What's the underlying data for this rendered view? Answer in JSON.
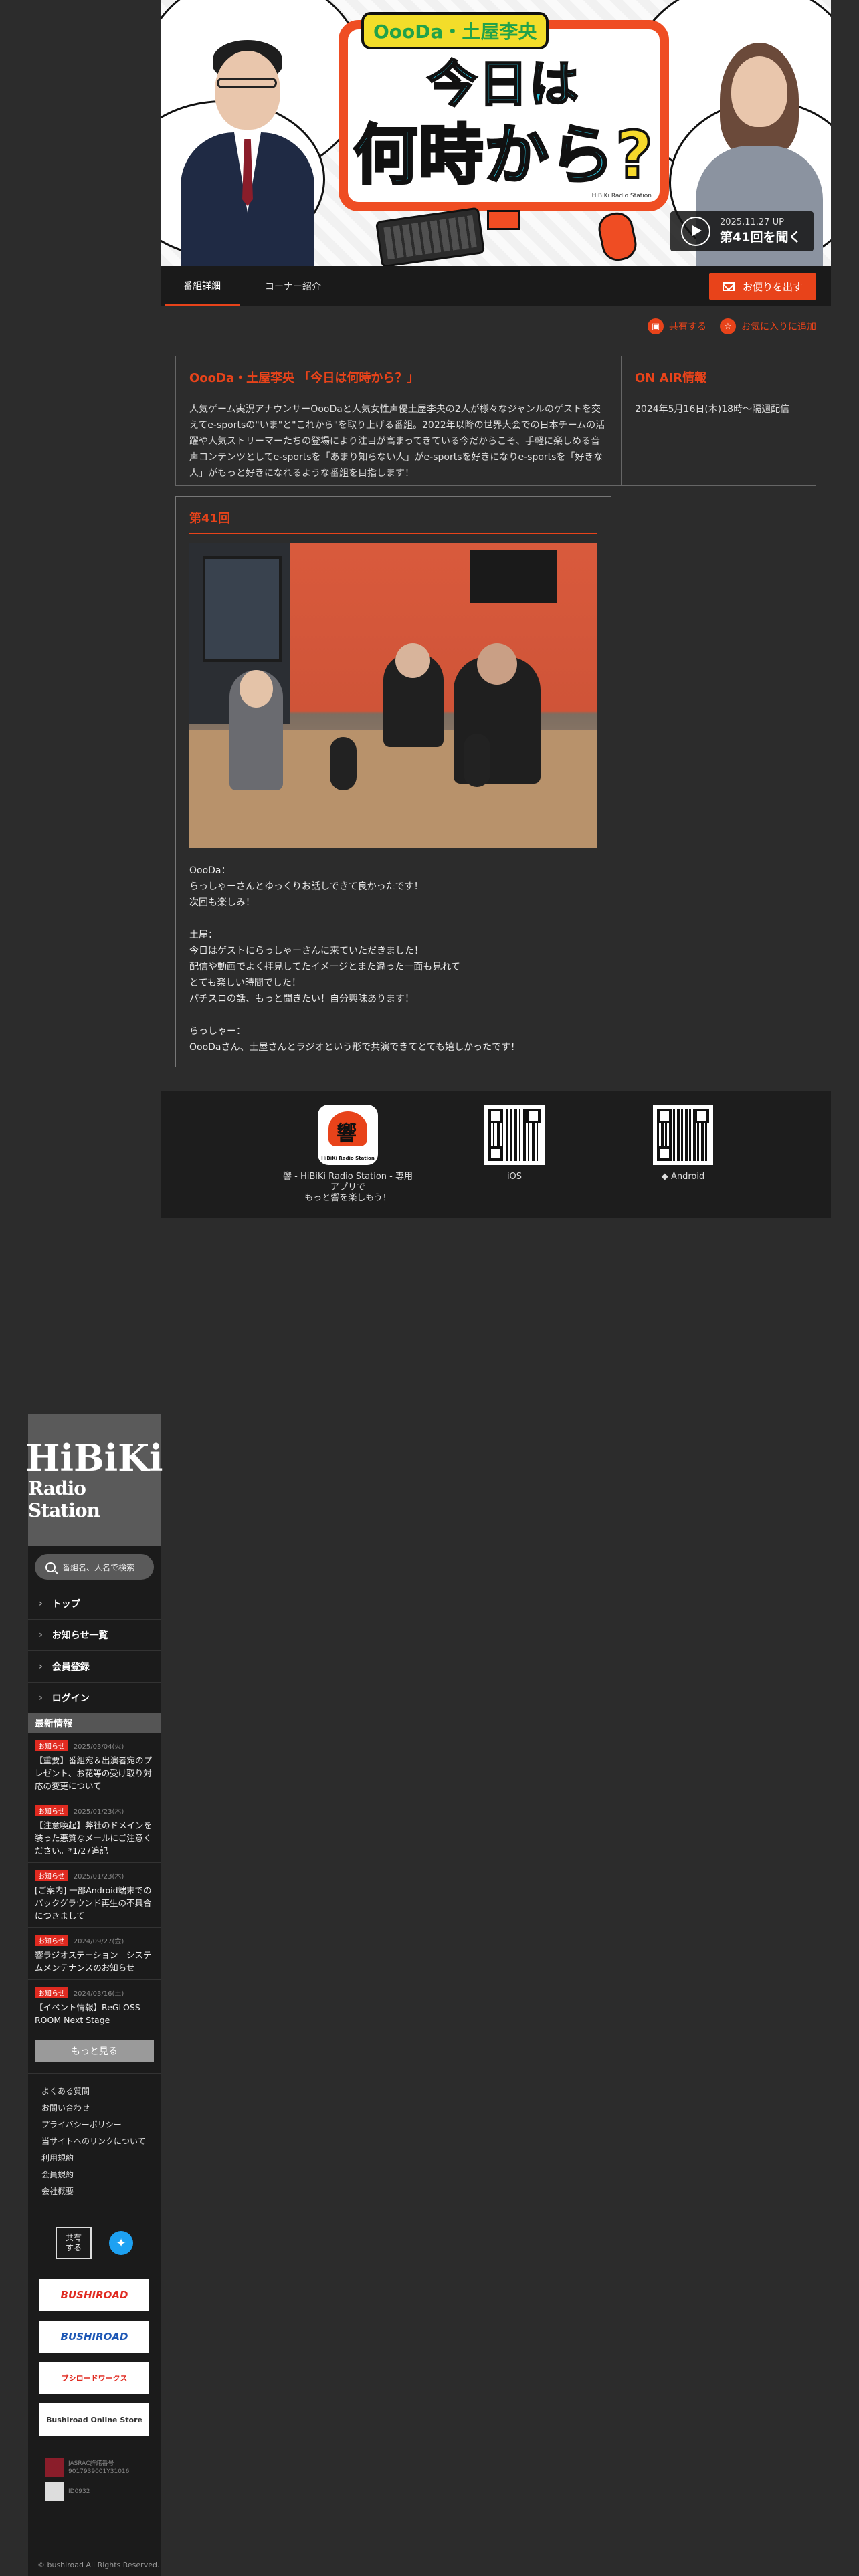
{
  "banner": {
    "logo_top": "OooDa・土屋李央",
    "logo_line1": "今日は",
    "logo_line2_a": "何時から",
    "logo_line2_b": "?",
    "credit": "HiBiKi Radio Station",
    "latest_date": "2025.11.27 UP",
    "latest_label": "第41回を聞く"
  },
  "tabs": [
    {
      "label": "番組詳細"
    },
    {
      "label": "コーナー紹介"
    }
  ],
  "letter_button": "お便りを出す",
  "actions": {
    "share": "共有する",
    "favorite": "お気に入りに追加"
  },
  "program": {
    "title": "OooDa・土屋李央 「今日は何時から？」",
    "description": "人気ゲーム実況アナウンサーOooDaと人気女性声優土屋李央の2人が様々なジャンルのゲストを交えてe-sportsの\"いま\"と\"これから\"を取り上げる番組。2022年以降の世界大会での日本チームの活躍や人気ストリーマーたちの登場により注目が高まってきている今だからこそ、手軽に楽しめる音声コンテンツとしてe-sportsを「あまり知らない人」がe-sportsを好きになりe-sportsを「好きな人」がもっと好きになれるような番組を目指します！",
    "onair_title": "ON AIR情報",
    "onair_text": "2024年5月16日(木)18時〜隔週配信"
  },
  "episode": {
    "title": "第41回",
    "paragraphs": [
      "OooDa：\nらっしゃーさんとゆっくりお話しできて良かったです！\n次回も楽しみ！",
      "土屋：\n今日はゲストにらっしゃーさんに来ていただきました！\n配信や動画でよく拝見してたイメージとまた違った一面も見れて\nとても楽しい時間でした！\nパチスロの話、もっと聞きたい！自分興味あります！",
      "らっしゃー：\nOooDaさん、土屋さんとラジオという形で共演できてとても嬉しかったです！"
    ]
  },
  "apps": {
    "app_caption": "響 - HiBiKi Radio Station - 専用アプリで\nもっと響を楽しもう！",
    "app_icon_text": "HiBiKi Radio Station",
    "ios": "iOS",
    "android": "Android"
  },
  "sidebar": {
    "logo_a": "HiBiKi",
    "logo_b": "Radio Station",
    "search_placeholder": "番組名、人名で検索",
    "nav": [
      "トップ",
      "お知らせ一覧",
      "会員登録",
      "ログイン"
    ],
    "news_heading": "最新情報",
    "news": [
      {
        "badge": "お知らせ",
        "date": "2025/03/04(火)",
        "text": "【重要】番組宛＆出演者宛のプレゼント、お花等の受け取り対応の変更について"
      },
      {
        "badge": "お知らせ",
        "date": "2025/01/23(木)",
        "text": "【注意喚起】弊社のドメインを装った悪質なメールにご注意ください。*1/27追記"
      },
      {
        "badge": "お知らせ",
        "date": "2025/01/23(木)",
        "text": "[ご案内] 一部Android端末でのバックグラウンド再生の不具合につきまして"
      },
      {
        "badge": "お知らせ",
        "date": "2024/09/27(金)",
        "text": "響ラジオステーション　システムメンテナンスのお知らせ"
      },
      {
        "badge": "お知らせ",
        "date": "2024/03/16(土)",
        "text": "【イベント情報】ReGLOSS ROOM Next Stage"
      }
    ],
    "more": "もっと見る",
    "footer_links": [
      "よくある質問",
      "お問い合わせ",
      "プライバシーポリシー",
      "当サイトへのリンクについて",
      "利用規約",
      "会員規約",
      "会社概要"
    ],
    "share_label": "共有\nする",
    "sponsors": [
      "BUSHIROAD",
      "BUSHIROAD",
      "ブシロードワークス",
      "Bushiroad Online Store"
    ],
    "license1": "JASRAC許諾番号\n9017939001Y31016",
    "license2": "ID0932",
    "copyright": "© bushiroad All Rights Reserved."
  },
  "colors": {
    "accent": "#e8431a",
    "bg": "#2c2c2c",
    "panel": "#1b1b1b",
    "twitter": "#1da1f2"
  }
}
